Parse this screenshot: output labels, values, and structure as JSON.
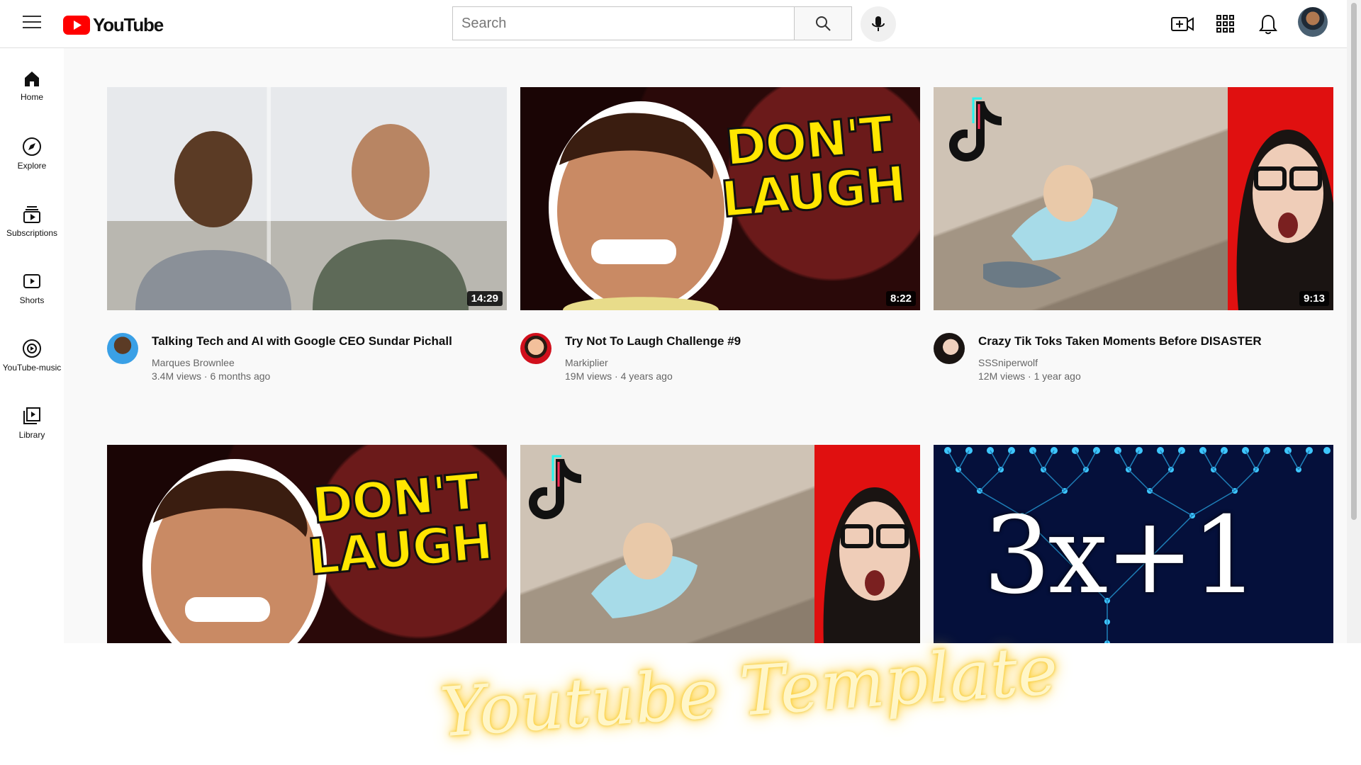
{
  "header": {
    "logo_text": "YouTube",
    "search_placeholder": "Search"
  },
  "sidebar": {
    "items": [
      {
        "label": "Home",
        "icon": "home-icon"
      },
      {
        "label": "Explore",
        "icon": "compass-icon"
      },
      {
        "label": "Subscriptions",
        "icon": "subscriptions-icon"
      },
      {
        "label": "Shorts",
        "icon": "shorts-icon"
      },
      {
        "label": "YouTube-music",
        "icon": "music-icon"
      },
      {
        "label": "Library",
        "icon": "library-icon"
      }
    ]
  },
  "videos": [
    {
      "title": "Talking Tech and AI with Google CEO Sundar Pichall",
      "channel": "Marques Brownlee",
      "stats": "3.4M views · 6 months ago",
      "duration": "14:29"
    },
    {
      "title": "Try Not To Laugh Challenge #9",
      "channel": "Markiplier",
      "stats": "19M views · 4 years ago",
      "duration": "8:22"
    },
    {
      "title": "Crazy Tik Toks Taken Moments Before DISASTER",
      "channel": "SSSniperwolf",
      "stats": "12M views · 1 year ago",
      "duration": "9:13"
    },
    {
      "title": "",
      "channel": "",
      "stats": "",
      "duration": ""
    },
    {
      "title": "",
      "channel": "",
      "stats": "",
      "duration": ""
    },
    {
      "title": "",
      "channel": "",
      "stats": "",
      "duration": ""
    }
  ],
  "thumb_text": {
    "dont": "DON'T",
    "laugh": "LAUGH",
    "math": "3x+1"
  },
  "watermark": "Youtube Template",
  "colors": {
    "brand_red": "#ff0000",
    "watermark_glow": "#ffd23f"
  }
}
